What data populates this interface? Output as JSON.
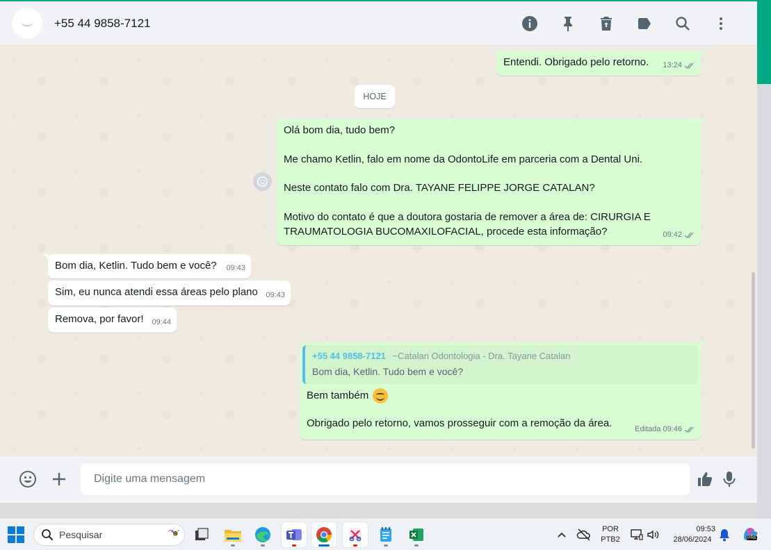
{
  "header": {
    "contact": "+55 44 9858-7121",
    "icons": [
      "info-icon",
      "pin-icon",
      "delete-icon",
      "label-icon",
      "search-icon",
      "menu-icon"
    ]
  },
  "chat": {
    "msg_prev": {
      "text": "Entendi. Obrigado pelo retorno.",
      "time": "13:24"
    },
    "day_chip": "HOJE",
    "msg_long": {
      "p1": "Olá bom dia, tudo bem?",
      "p2": "Me chamo Ketlin, falo em nome da OdontoLife em parceria com a Dental Uni.",
      "p3": "Neste contato falo com Dra. TAYANE FELIPPE JORGE CATALAN?",
      "p4": "Motivo do contato é que a doutora gostaria de remover a área de: CIRURGIA E TRAUMATOLOGIA BUCOMAXILOFACIAL, procede esta informação?",
      "time": "09:42"
    },
    "incoming": [
      {
        "text": "Bom dia, Ketlin. Tudo bem e você?",
        "time": "09:43"
      },
      {
        "text": "Sim, eu nunca atendi essa áreas pelo plano",
        "time": "09:43"
      },
      {
        "text": "Remova, por favor!",
        "time": "09:44"
      }
    ],
    "reply": {
      "quote_number": "+55 44 9858-7121",
      "quote_alias": "~Catalan Odontologia - Dra. Tayane Catalan",
      "quote_text": "Bom dia, Ketlin. Tudo bem e você?",
      "line1": "Bem também",
      "line2": "Obrigado pelo retorno, vamos prosseguir com a remoção da área.",
      "edited": "Editada",
      "time": "09:46"
    }
  },
  "footer": {
    "placeholder": "Digite uma mensagem"
  },
  "taskbar": {
    "search_label": "Pesquisar",
    "lang_line1": "POR",
    "lang_line2": "PTB2",
    "time": "09:53",
    "date": "28/06/2024",
    "copilot_badge": "PRE"
  },
  "colors": {
    "accent": "#00a884",
    "outgoing_bubble": "#d9fdd3",
    "incoming_bubble": "#ffffff",
    "quote_name": "#53bdeb"
  }
}
